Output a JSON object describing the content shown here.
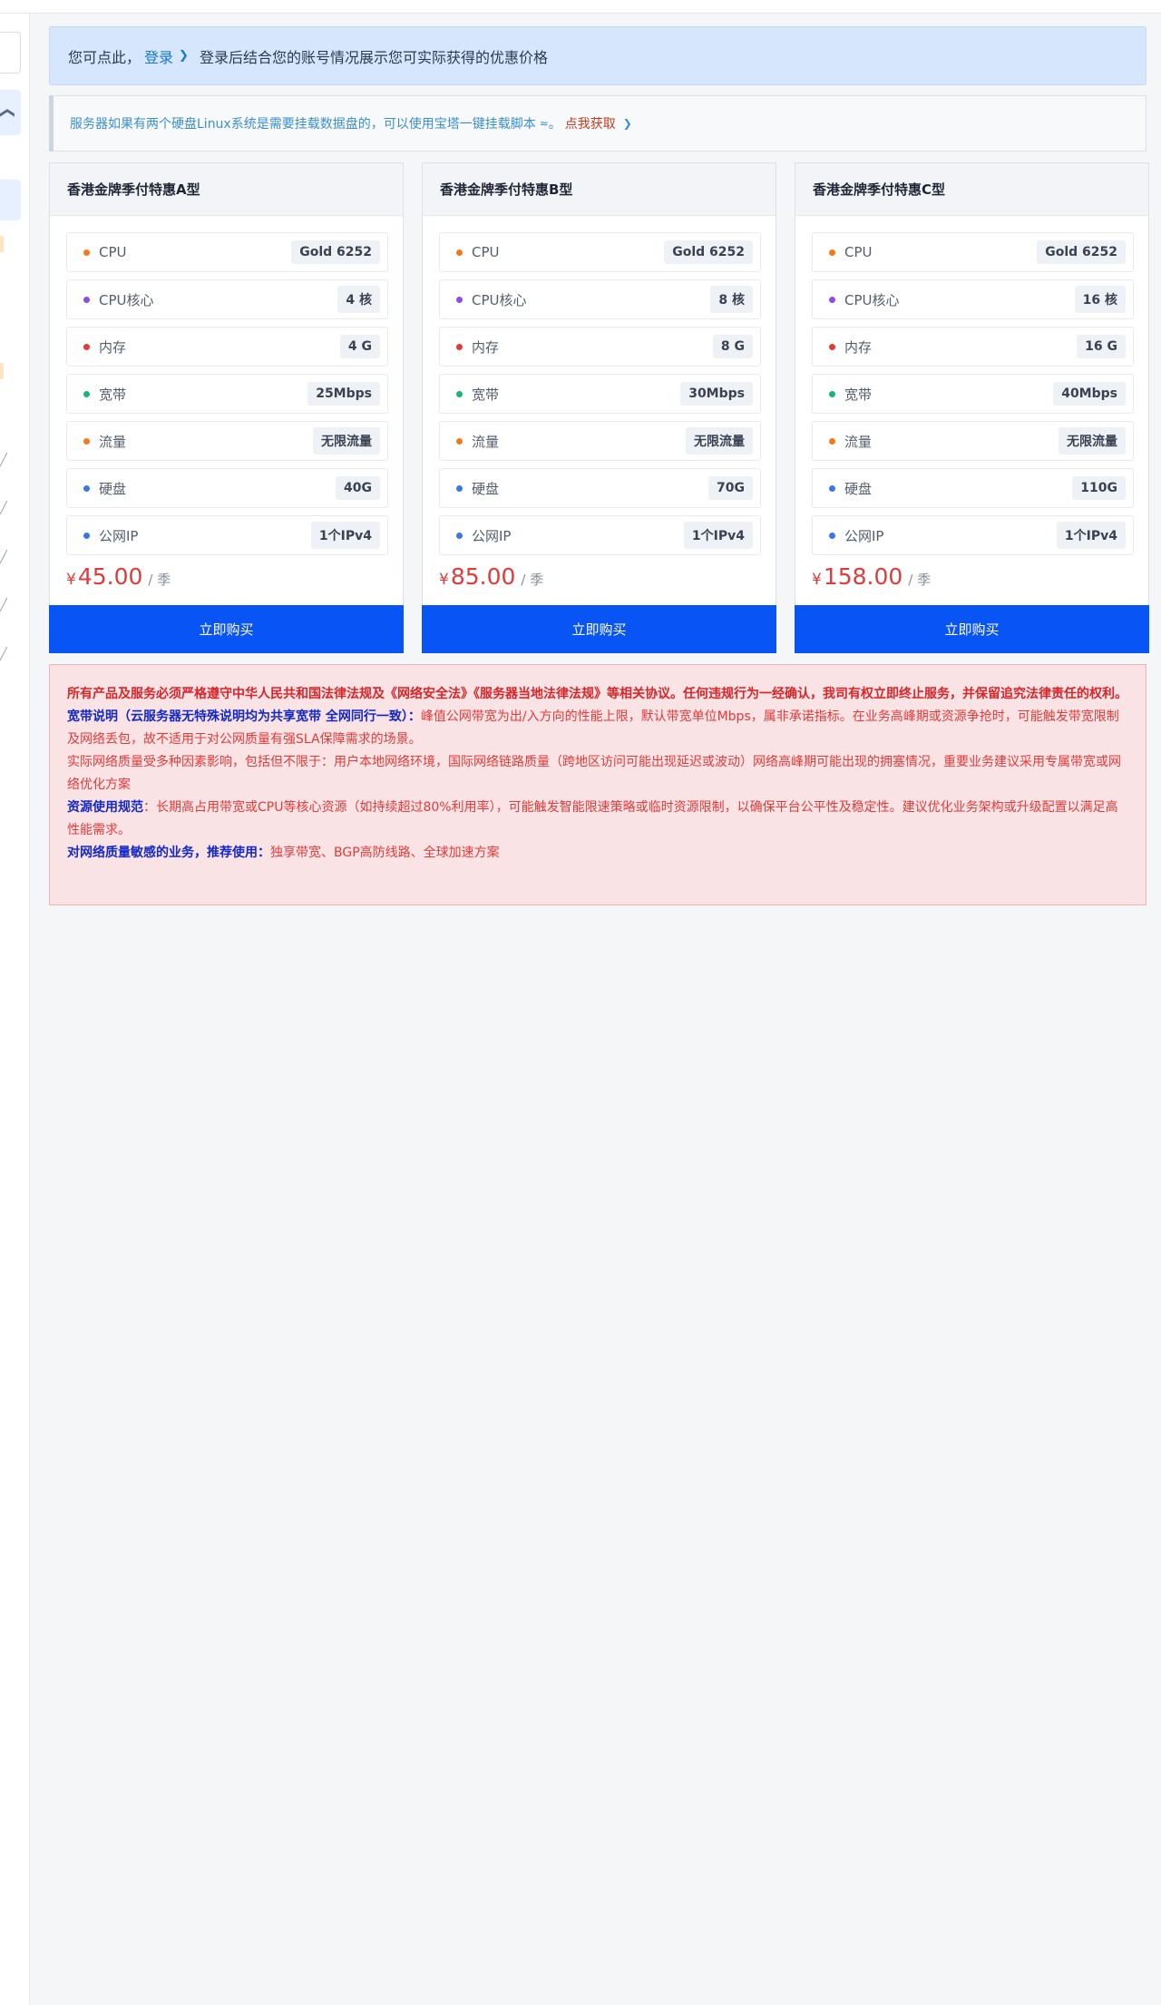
{
  "login_banner": {
    "prefix": "您可点此，",
    "link": "登录",
    "suffix": "登录后结合您的账号情况展示您可实际获得的优惠价格"
  },
  "tip": {
    "text": "服务器如果有两个硬盘Linux系统是需要挂载数据盘的，可以使用宝塔一键挂载脚本",
    "icon": "≈",
    "end": "。",
    "link": "点我获取"
  },
  "products": [
    {
      "title": "香港金牌季付特惠A型",
      "specs": [
        {
          "label": "CPU",
          "value": "Gold 6252",
          "color": "#f07a1a"
        },
        {
          "label": "CPU核心",
          "value": "4 核",
          "color": "#8a4fe0"
        },
        {
          "label": "内存",
          "value": "4 G",
          "color": "#e03a3a"
        },
        {
          "label": "宽带",
          "value": "25Mbps",
          "color": "#18b47a"
        },
        {
          "label": "流量",
          "value": "无限流量",
          "color": "#f07a1a"
        },
        {
          "label": "硬盘",
          "value": "40G",
          "color": "#3a78e0"
        },
        {
          "label": "公网IP",
          "value": "1个IPv4",
          "color": "#3a78e0"
        }
      ],
      "currency": "¥",
      "price": "45.00",
      "unit": "/ 季",
      "buy_label": "立即购买"
    },
    {
      "title": "香港金牌季付特惠B型",
      "specs": [
        {
          "label": "CPU",
          "value": "Gold 6252",
          "color": "#f07a1a"
        },
        {
          "label": "CPU核心",
          "value": "8 核",
          "color": "#8a4fe0"
        },
        {
          "label": "内存",
          "value": "8 G",
          "color": "#e03a3a"
        },
        {
          "label": "宽带",
          "value": "30Mbps",
          "color": "#18b47a"
        },
        {
          "label": "流量",
          "value": "无限流量",
          "color": "#f07a1a"
        },
        {
          "label": "硬盘",
          "value": "70G",
          "color": "#3a78e0"
        },
        {
          "label": "公网IP",
          "value": "1个IPv4",
          "color": "#3a78e0"
        }
      ],
      "currency": "¥",
      "price": "85.00",
      "unit": "/ 季",
      "buy_label": "立即购买"
    },
    {
      "title": "香港金牌季付特惠C型",
      "specs": [
        {
          "label": "CPU",
          "value": "Gold 6252",
          "color": "#f07a1a"
        },
        {
          "label": "CPU核心",
          "value": "16 核",
          "color": "#8a4fe0"
        },
        {
          "label": "内存",
          "value": "16 G",
          "color": "#e03a3a"
        },
        {
          "label": "宽带",
          "value": "40Mbps",
          "color": "#18b47a"
        },
        {
          "label": "流量",
          "value": "无限流量",
          "color": "#f07a1a"
        },
        {
          "label": "硬盘",
          "value": "110G",
          "color": "#3a78e0"
        },
        {
          "label": "公网IP",
          "value": "1个IPv4",
          "color": "#3a78e0"
        }
      ],
      "currency": "¥",
      "price": "158.00",
      "unit": "/ 季",
      "buy_label": "立即购买"
    }
  ],
  "notice": {
    "legal": "所有产品及服务必须严格遵守中华人民共和国法律法规及《网络安全法》《服务器当地法律法规》等相关协议。任何违规行为一经确认，我司有权立即终止服务，并保留追究法律责任的权利。",
    "bandwidth_title": "宽带说明（云服务器无特殊说明均为共享宽带 全网同行一致）：",
    "bandwidth_text": "峰值公网带宽为出/入方向的性能上限，默认带宽单位Mbps，属非承诺指标。在业务高峰期或资源争抢时，可能触发带宽限制及网络丢包，故不适用于对公网质量有强SLA保障需求的场景。",
    "quality_text": "实际网络质量受多种因素影响，包括但不限于：用户本地网络环境，国际网络链路质量（跨地区访问可能出现延迟或波动）网络高峰期可能出现的拥塞情况，重要业务建议采用专属带宽或网络优化方案",
    "resource_title": "资源使用规范",
    "resource_text": "：长期高占用带宽或CPU等核心资源（如持续超过80%利用率），可能触发智能限速策略或临时资源限制，以确保平台公平性及稳定性。建议优化业务架构或升级配置以满足高性能需求。",
    "recommend_title": "对网络质量敏感的业务，推荐使用：",
    "recommend_text": "独享带宽、BGP高防线路、全球加速方案"
  }
}
